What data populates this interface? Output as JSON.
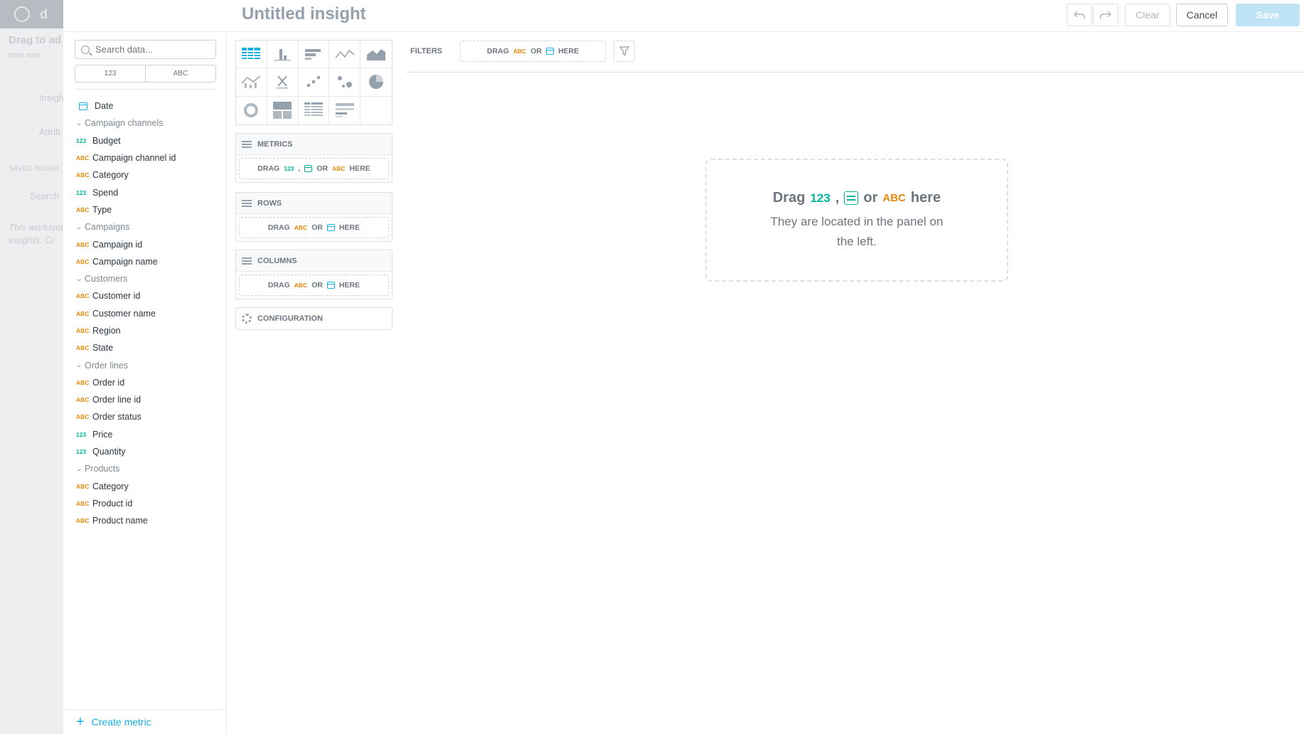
{
  "header": {
    "title": "Untitled insight",
    "undo_icon": "undo-icon",
    "redo_icon": "redo-icon",
    "clear_label": "Clear",
    "cancel_label": "Cancel",
    "save_label": "Save"
  },
  "leftnav": {
    "items": [
      "Drag to ad",
      "date mas",
      "Insight",
      "Attrib",
      "SAVED INSIGH",
      "Search",
      "This workspa",
      "insights. Cr"
    ]
  },
  "datapanel": {
    "search_placeholder": "Search data...",
    "type_filter": [
      "123",
      "ABC"
    ],
    "catalog": [
      {
        "kind": "date",
        "label": "Date"
      },
      {
        "kind": "group",
        "label": "Campaign channels"
      },
      {
        "kind": "num",
        "tag": "123",
        "label": "Budget"
      },
      {
        "kind": "abc",
        "tag": "ABC",
        "label": "Campaign channel id"
      },
      {
        "kind": "abc",
        "tag": "ABC",
        "label": "Category"
      },
      {
        "kind": "num",
        "tag": "123",
        "label": "Spend"
      },
      {
        "kind": "abc",
        "tag": "ABC",
        "label": "Type"
      },
      {
        "kind": "group",
        "label": "Campaigns"
      },
      {
        "kind": "abc",
        "tag": "ABC",
        "label": "Campaign id"
      },
      {
        "kind": "abc",
        "tag": "ABC",
        "label": "Campaign name"
      },
      {
        "kind": "group",
        "label": "Customers"
      },
      {
        "kind": "abc",
        "tag": "ABC",
        "label": "Customer id"
      },
      {
        "kind": "abc",
        "tag": "ABC",
        "label": "Customer name"
      },
      {
        "kind": "abc",
        "tag": "ABC",
        "label": "Region"
      },
      {
        "kind": "abc",
        "tag": "ABC",
        "label": "State"
      },
      {
        "kind": "group",
        "label": "Order lines"
      },
      {
        "kind": "abc",
        "tag": "ABC",
        "label": "Order id"
      },
      {
        "kind": "abc",
        "tag": "ABC",
        "label": "Order line id"
      },
      {
        "kind": "abc",
        "tag": "ABC",
        "label": "Order status"
      },
      {
        "kind": "num",
        "tag": "123",
        "label": "Price"
      },
      {
        "kind": "num",
        "tag": "123",
        "label": "Quantity"
      },
      {
        "kind": "group",
        "label": "Products"
      },
      {
        "kind": "abc",
        "tag": "ABC",
        "label": "Category"
      },
      {
        "kind": "abc",
        "tag": "ABC",
        "label": "Product id"
      },
      {
        "kind": "abc",
        "tag": "ABC",
        "label": "Product name"
      }
    ],
    "create_metric_label": "Create metric"
  },
  "viz_types": [
    "table-icon",
    "column-chart-icon",
    "bar-chart-icon",
    "line-chart-icon",
    "area-chart-icon",
    "combo-chart-icon",
    "headline-icon",
    "scatter-plot-icon",
    "bubble-chart-icon",
    "pie-chart-icon",
    "donut-chart-icon",
    "treemap-icon",
    "heatmap-icon",
    "bullet-chart-icon",
    "empty-slot"
  ],
  "buckets": {
    "metrics": {
      "title": "METRICS",
      "drag": "DRAG",
      "num": "123",
      "comma": ",",
      "or": "OR",
      "abc": "ABC",
      "here": "HERE"
    },
    "rows": {
      "title": "ROWS",
      "drag": "DRAG",
      "abc": "ABC",
      "or": "OR",
      "here": "HERE"
    },
    "columns": {
      "title": "COLUMNS",
      "drag": "DRAG",
      "abc": "ABC",
      "or": "OR",
      "here": "HERE"
    },
    "configuration": {
      "title": "CONFIGURATION"
    }
  },
  "filters": {
    "label": "FILTERS",
    "drag": "DRAG",
    "abc": "ABC",
    "or": "OR",
    "here": "HERE"
  },
  "empty_state": {
    "drag": "Drag",
    "num": "123",
    "comma": ",",
    "or": "or",
    "abc": "ABC",
    "here": "here",
    "hint": "They are located in the panel on the left."
  },
  "colors": {
    "accent": "#14b2e2",
    "abc": "#e38a0b",
    "num": "#00b49a",
    "save_disabled": "#bde3f5"
  }
}
